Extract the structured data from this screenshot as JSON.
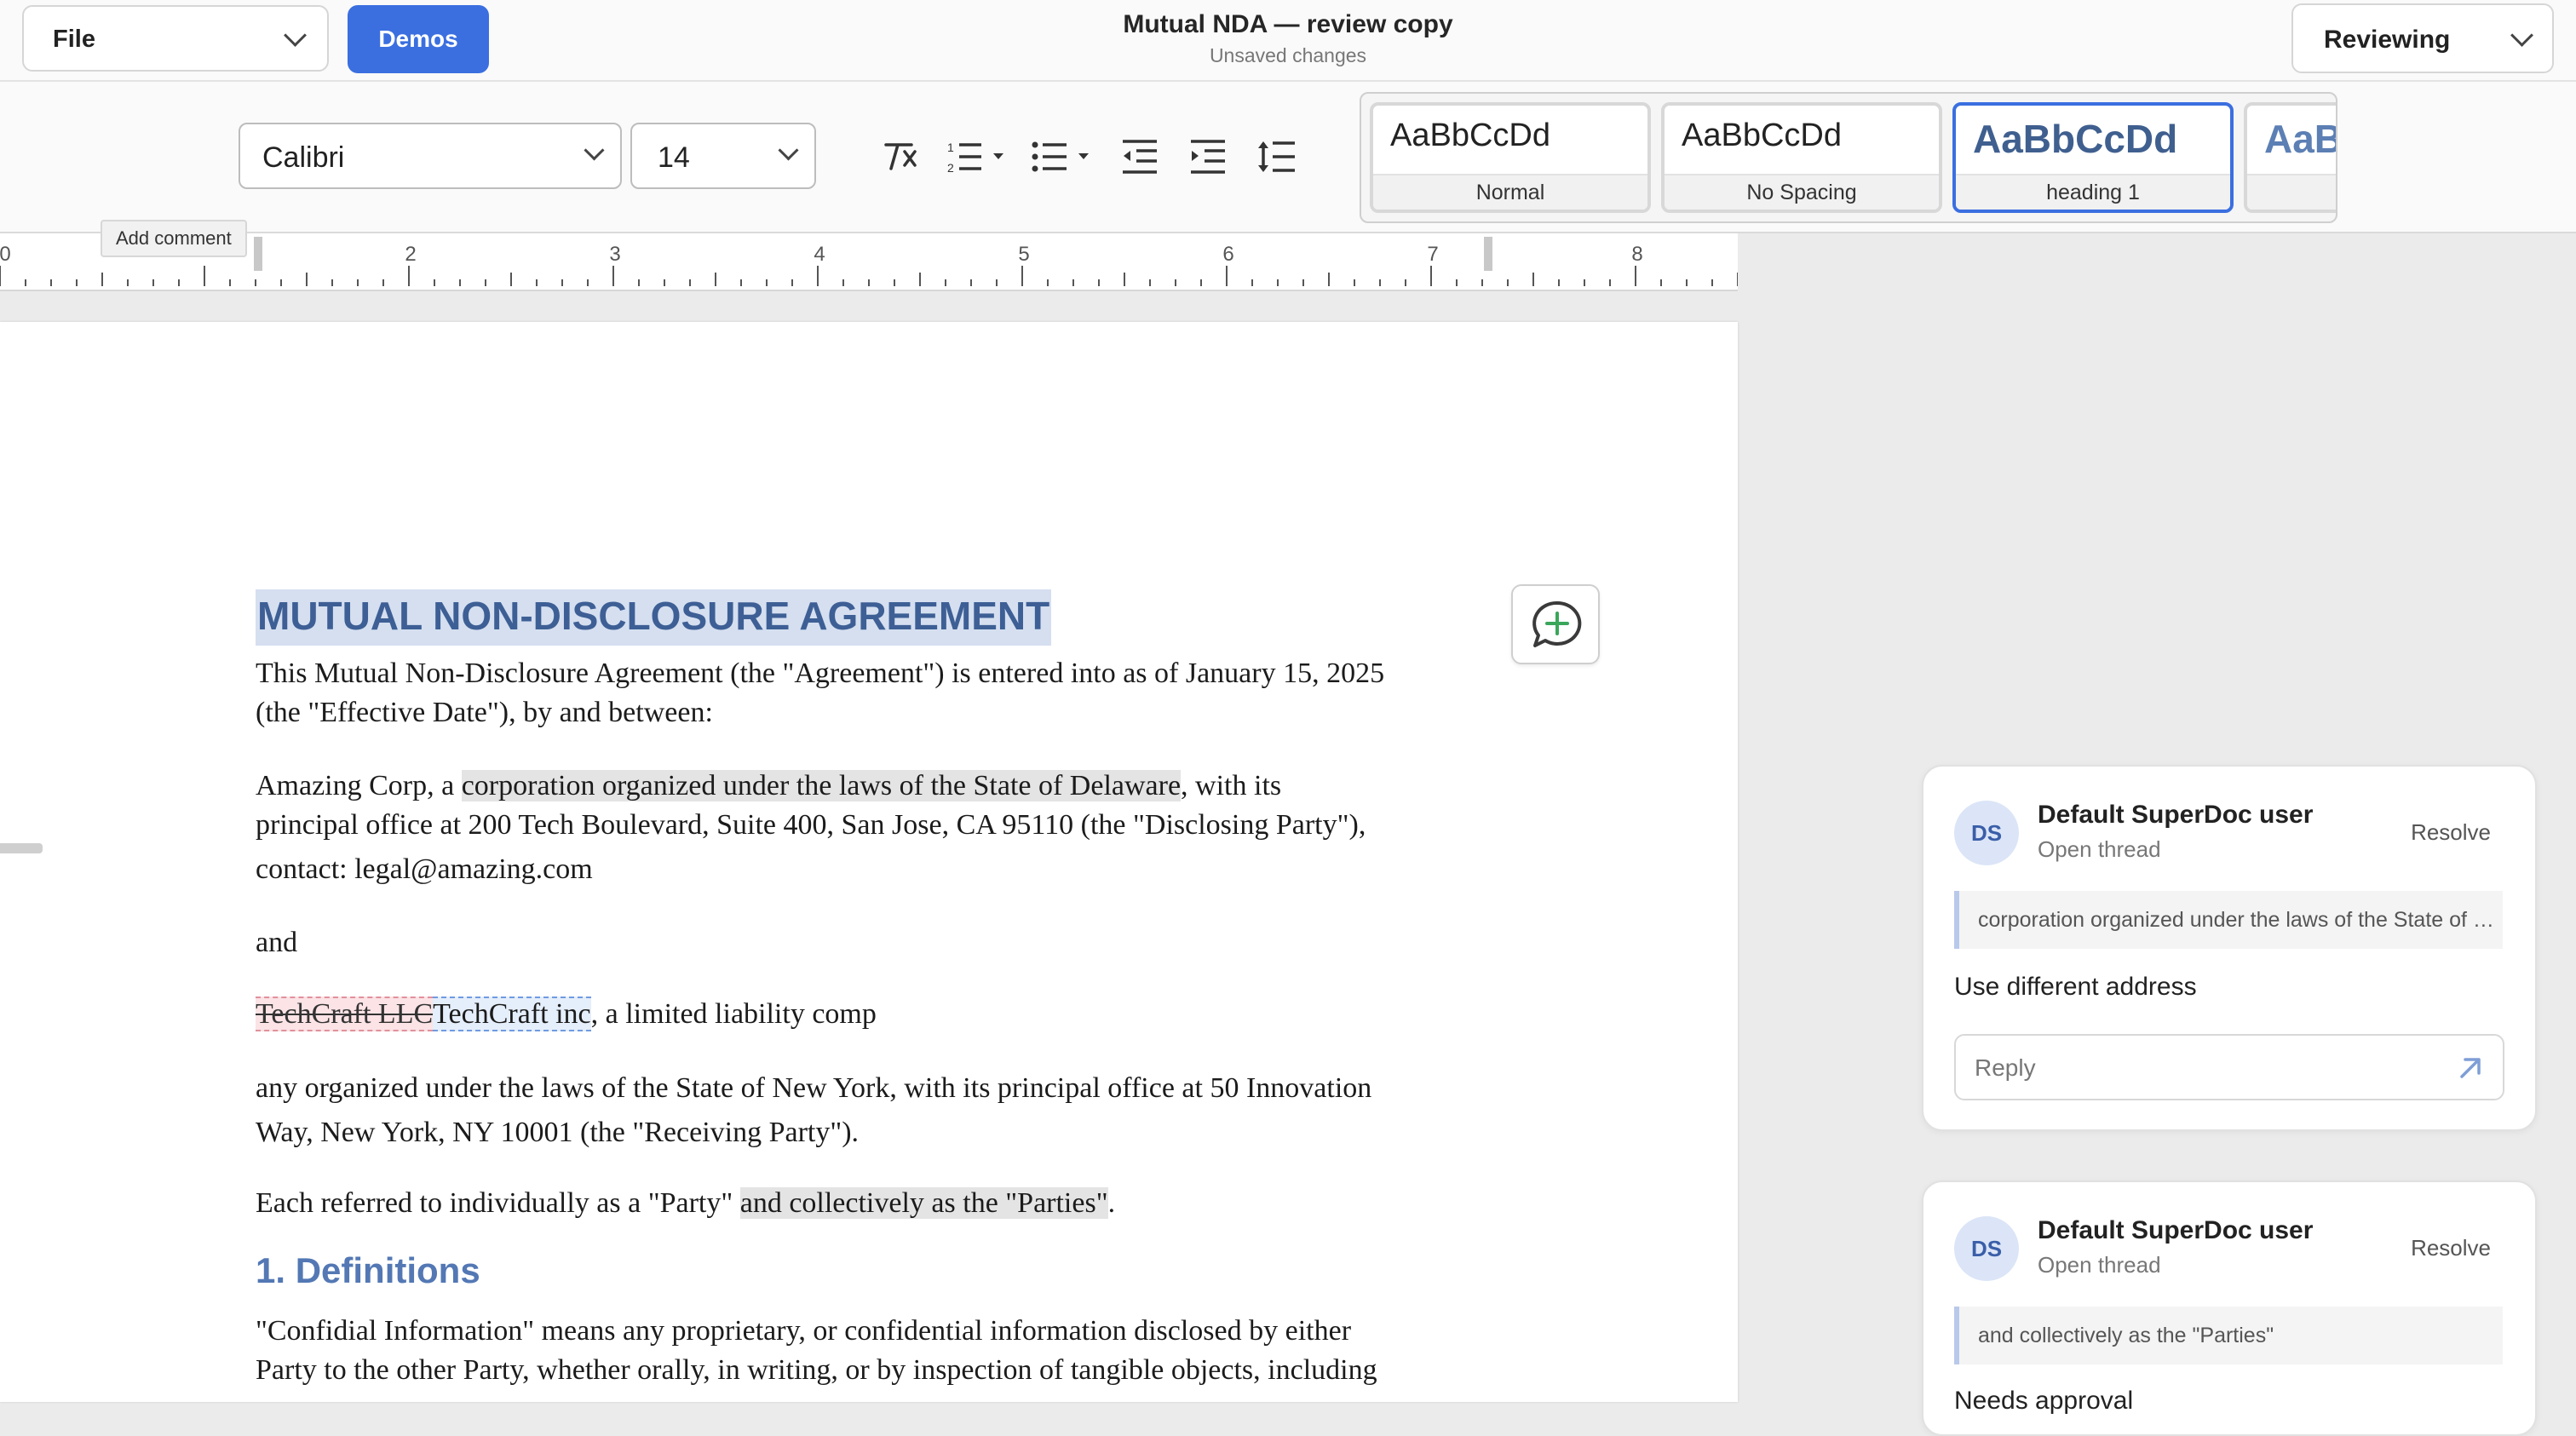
{
  "app": {
    "file_label": "File",
    "demos_label": "Demos",
    "title": "Mutual NDA — review copy",
    "status": "Unsaved changes",
    "mode": "Reviewing"
  },
  "toolbar": {
    "font_family": "Calibri",
    "font_size": "14",
    "icons": [
      "clear-format-icon",
      "numbered-list-icon",
      "bullet-list-icon",
      "outdent-icon",
      "indent-icon",
      "line-spacing-icon"
    ],
    "styles": [
      {
        "sample": "AaBbCcDd",
        "name": "Normal"
      },
      {
        "sample": "AaBbCcDd",
        "name": "No Spacing"
      },
      {
        "sample": "AaBbCcDd",
        "name": "heading 1"
      },
      {
        "sample": "AaB",
        "name": ""
      }
    ]
  },
  "ruler": {
    "tooltip": "Add comment",
    "numbers": [
      "0",
      "2",
      "3",
      "4",
      "5",
      "6",
      "7",
      "8"
    ]
  },
  "document": {
    "title": "MUTUAL NON-DISCLOSURE AGREEMENT",
    "p1": "This Mutual Non-Disclosure Agreement (the \"Agreement\") is entered into as of January 15, 2025",
    "p1b": "(the \"Effective Date\"), by and between:",
    "p2_a": "Amazing Corp, a ",
    "p2_hl": "corporation organized under the laws of the State of Delaware",
    "p2_b": ", with its",
    "p2_c": "principal office at 200 Tech Boulevard, Suite 400, San Jose, CA 95110 (the \"Disclosing Party\"),",
    "p2_d": "contact: legal@amazing.com",
    "and": "and",
    "p3_del": "TechCraft LLC",
    "p3_ins": "TechCraft inc",
    "p3_rest": ", a limited liability comp",
    "p4": "any organized under the laws of the State of New York, with its principal office at 50 Innovation",
    "p4b": "Way, New York, NY 10001 (the \"Receiving Party\").",
    "p5_a": "Each referred to individually as a \"Party\" ",
    "p5_hl": "and collectively as the \"Parties\"",
    "p5_b": ".",
    "h_def": "1. Definitions",
    "p6": "\"Confidial Information\" means any proprietary, or confidential information disclosed by either",
    "p6b": "Party to the other Party, whether orally, in writing, or by inspection of tangible objects, including"
  },
  "comments": [
    {
      "initials": "DS",
      "author": "Default SuperDoc user",
      "status": "Open thread",
      "resolve": "Resolve",
      "quote": "corporation organized under the laws of the State of Delaware",
      "text": "Use different address",
      "reply_placeholder": "Reply"
    },
    {
      "initials": "DS",
      "author": "Default SuperDoc user",
      "status": "Open thread",
      "resolve": "Resolve",
      "quote": "and collectively as the \"Parties\"",
      "text": "Needs approval"
    }
  ]
}
